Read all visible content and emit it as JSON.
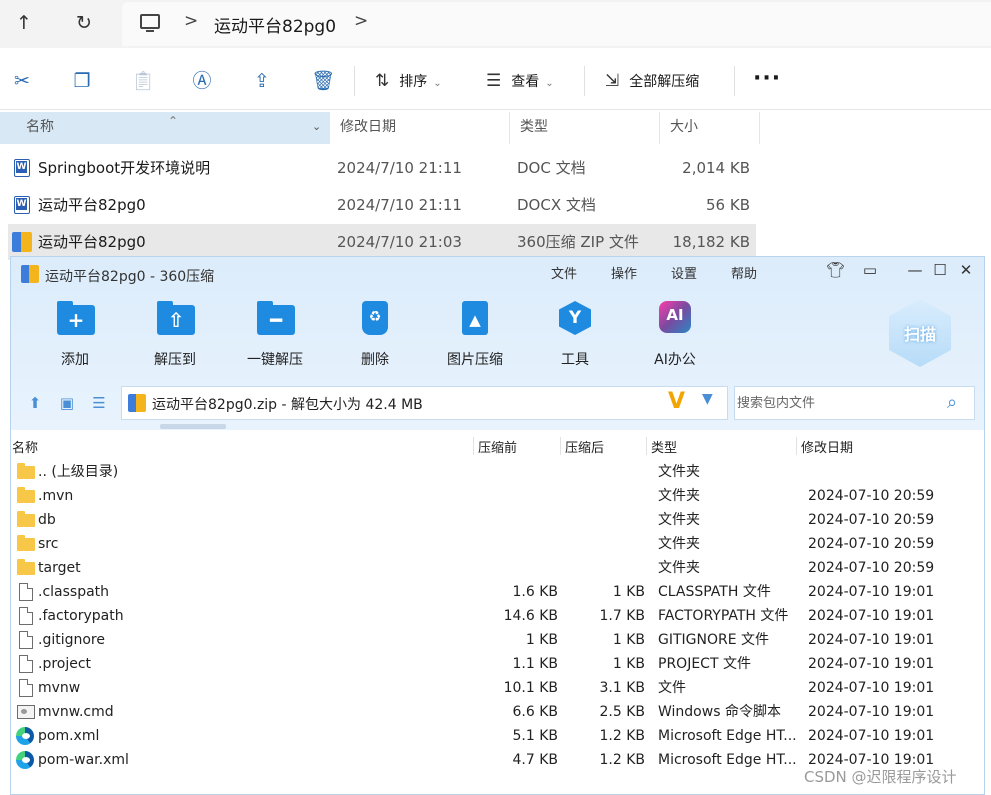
{
  "explorer": {
    "nav": {
      "up_icon": "arrow-up-icon",
      "refresh_icon": "refresh-icon"
    },
    "breadcrumb": {
      "location_icon": "this-pc-icon",
      "separator": ">",
      "folder": "运动平台82pg0",
      "trailing": ">"
    },
    "commands": {
      "sort_label": "排序",
      "view_label": "查看",
      "extract_all_label": "全部解压缩",
      "more_label": "···"
    },
    "columns": {
      "name": "名称",
      "date": "修改日期",
      "type": "类型",
      "size": "大小"
    },
    "files": [
      {
        "name": "Springboot开发环境说明",
        "date": "2024/7/10 21:11",
        "type": "DOC 文档",
        "size": "2,014 KB",
        "icon": "word-doc-icon"
      },
      {
        "name": "运动平台82pg0",
        "date": "2024/7/10 21:11",
        "type": "DOCX 文档",
        "size": "56 KB",
        "icon": "word-doc-icon"
      },
      {
        "name": "运动平台82pg0",
        "date": "2024/7/10 21:03",
        "type": "360压缩 ZIP 文件",
        "size": "18,182 KB",
        "icon": "zip-archive-icon",
        "selected": true
      }
    ]
  },
  "zip_window": {
    "title": "运动平台82pg0 - 360压缩",
    "menu": [
      "文件",
      "操作",
      "设置",
      "帮助"
    ],
    "toolbar": [
      {
        "label": "添加",
        "icon": "add-to-archive-icon"
      },
      {
        "label": "解压到",
        "icon": "extract-to-icon"
      },
      {
        "label": "一键解压",
        "icon": "one-click-extract-icon"
      },
      {
        "label": "删除",
        "icon": "delete-icon"
      },
      {
        "label": "图片压缩",
        "icon": "image-compress-icon"
      },
      {
        "label": "工具",
        "icon": "tools-icon"
      },
      {
        "label": "AI办公",
        "icon": "ai-office-icon"
      }
    ],
    "scan_label": "扫描",
    "ai_glyph": "AI",
    "address_text": "运动平台82pg0.zip - 解包大小为 42.4 MB",
    "search_placeholder": "搜索包内文件",
    "columns": {
      "name": "名称",
      "before": "压缩前",
      "after": "压缩后",
      "type": "类型",
      "date": "修改日期"
    },
    "rows": [
      {
        "name": ".. (上级目录)",
        "before": "",
        "after": "",
        "type": "文件夹",
        "date": "",
        "icon": "folder"
      },
      {
        "name": ".mvn",
        "before": "",
        "after": "",
        "type": "文件夹",
        "date": "2024-07-10 20:59",
        "icon": "folder"
      },
      {
        "name": "db",
        "before": "",
        "after": "",
        "type": "文件夹",
        "date": "2024-07-10 20:59",
        "icon": "folder"
      },
      {
        "name": "src",
        "before": "",
        "after": "",
        "type": "文件夹",
        "date": "2024-07-10 20:59",
        "icon": "folder"
      },
      {
        "name": "target",
        "before": "",
        "after": "",
        "type": "文件夹",
        "date": "2024-07-10 20:59",
        "icon": "folder"
      },
      {
        "name": ".classpath",
        "before": "1.6 KB",
        "after": "1 KB",
        "type": "CLASSPATH 文件",
        "date": "2024-07-10 19:01",
        "icon": "file"
      },
      {
        "name": ".factorypath",
        "before": "14.6 KB",
        "after": "1.7 KB",
        "type": "FACTORYPATH 文件",
        "date": "2024-07-10 19:01",
        "icon": "file"
      },
      {
        "name": ".gitignore",
        "before": "1 KB",
        "after": "1 KB",
        "type": "GITIGNORE 文件",
        "date": "2024-07-10 19:01",
        "icon": "file"
      },
      {
        "name": ".project",
        "before": "1.1 KB",
        "after": "1 KB",
        "type": "PROJECT 文件",
        "date": "2024-07-10 19:01",
        "icon": "file"
      },
      {
        "name": "mvnw",
        "before": "10.1 KB",
        "after": "3.1 KB",
        "type": "文件",
        "date": "2024-07-10 19:01",
        "icon": "file"
      },
      {
        "name": "mvnw.cmd",
        "before": "6.6 KB",
        "after": "2.5 KB",
        "type": "Windows 命令脚本",
        "date": "2024-07-10 19:01",
        "icon": "cmd"
      },
      {
        "name": "pom.xml",
        "before": "5.1 KB",
        "after": "1.2 KB",
        "type": "Microsoft Edge HT...",
        "date": "2024-07-10 19:01",
        "icon": "edge"
      },
      {
        "name": "pom-war.xml",
        "before": "4.7 KB",
        "after": "1.2 KB",
        "type": "Microsoft Edge HT...",
        "date": "2024-07-10 19:01",
        "icon": "edge"
      }
    ]
  },
  "watermark": "CSDN @迟限程序设计",
  "colors": {
    "explorer_selected": "#e8e8e8",
    "name_header": "#d9e8f5",
    "accent_blue": "#1e8be0",
    "zip_top_bg": "#dcecfb",
    "folder_yellow": "#f7c847"
  }
}
